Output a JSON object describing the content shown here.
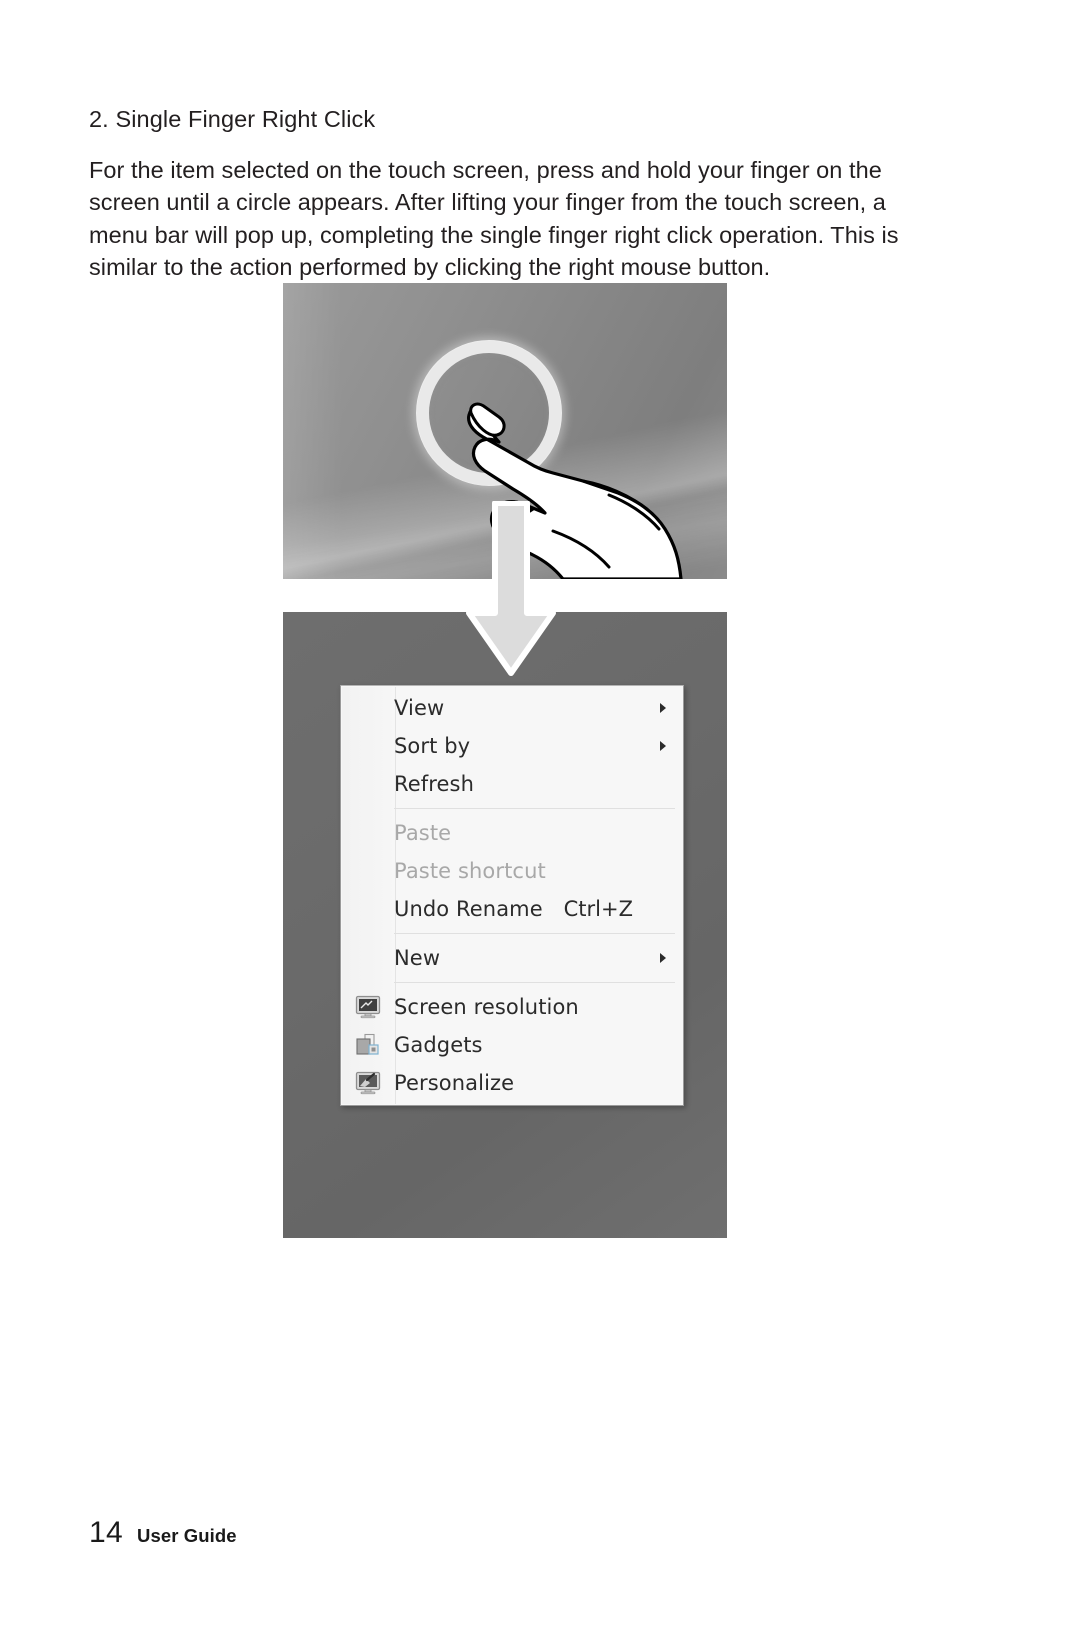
{
  "document": {
    "section_number": "2.",
    "heading": "Single Finger Right Click",
    "body": "For the item selected on the touch screen, press and hold your finger on the screen until a circle appears. After lifting your finger from the touch screen, a menu bar will pop up, completing the single finger right click operation. This is similar to the action performed by clicking the right mouse button."
  },
  "figure": {
    "top_panel": {
      "ring_icon": "touch-ring-icon",
      "hand_icon": "hand-pointing-finger-icon"
    },
    "arrow": {
      "icon": "down-arrow-icon"
    },
    "context_menu": {
      "groups": [
        {
          "items": [
            {
              "label": "View",
              "accel": "",
              "icon": "",
              "submenu": true,
              "disabled": false
            },
            {
              "label": "Sort by",
              "accel": "",
              "icon": "",
              "submenu": true,
              "disabled": false
            },
            {
              "label": "Refresh",
              "accel": "",
              "icon": "",
              "submenu": false,
              "disabled": false
            }
          ]
        },
        {
          "items": [
            {
              "label": "Paste",
              "accel": "",
              "icon": "",
              "submenu": false,
              "disabled": true
            },
            {
              "label": "Paste shortcut",
              "accel": "",
              "icon": "",
              "submenu": false,
              "disabled": true
            },
            {
              "label": "Undo Rename",
              "accel": "Ctrl+Z",
              "icon": "",
              "submenu": false,
              "disabled": false
            }
          ]
        },
        {
          "items": [
            {
              "label": "New",
              "accel": "",
              "icon": "",
              "submenu": true,
              "disabled": false
            }
          ]
        },
        {
          "items": [
            {
              "label": "Screen resolution",
              "accel": "",
              "icon": "monitor-icon",
              "submenu": false,
              "disabled": false
            },
            {
              "label": "Gadgets",
              "accel": "",
              "icon": "gadgets-icon",
              "submenu": false,
              "disabled": false
            },
            {
              "label": "Personalize",
              "accel": "",
              "icon": "personalize-brush-icon",
              "submenu": false,
              "disabled": false
            }
          ]
        }
      ]
    }
  },
  "footer": {
    "page_number": "14",
    "doc_title": "User Guide"
  },
  "colors": {
    "menu_background": "#f7f7f7",
    "menu_border": "#9a9a9a",
    "menu_text": "#2b2b2b",
    "menu_text_disabled": "#a8a8a8",
    "panel_top": "#8c8c8c",
    "panel_bottom": "#6a6a6a",
    "arrow_fill": "#dcdcdc",
    "arrow_stroke": "#ffffff",
    "body_text": "#231f20"
  }
}
